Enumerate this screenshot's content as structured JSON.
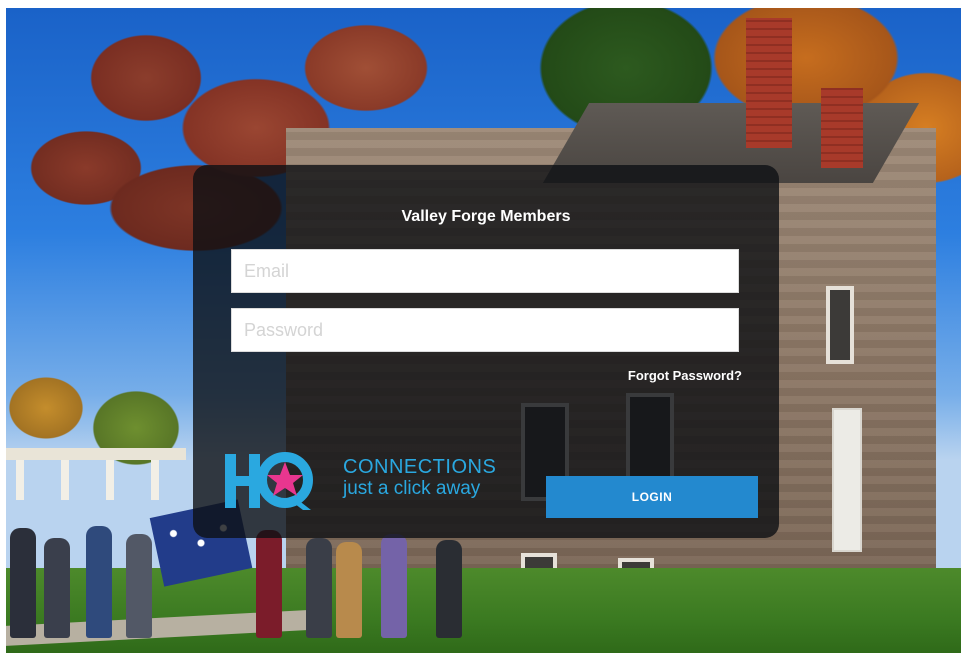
{
  "login": {
    "title": "Valley Forge Members",
    "email_placeholder": "Email",
    "email_value": "",
    "password_placeholder": "Password",
    "password_value": "",
    "forgot_label": "Forgot Password?",
    "login_label": "LOGIN"
  },
  "logo": {
    "mark_text": "HQ",
    "line1": "CONNECTIONS",
    "line2": "just a click away"
  },
  "colors": {
    "accent": "#2389cf",
    "logo_blue": "#2aa8e0",
    "logo_star": "#e8368f",
    "panel_bg": "#0e1014"
  }
}
